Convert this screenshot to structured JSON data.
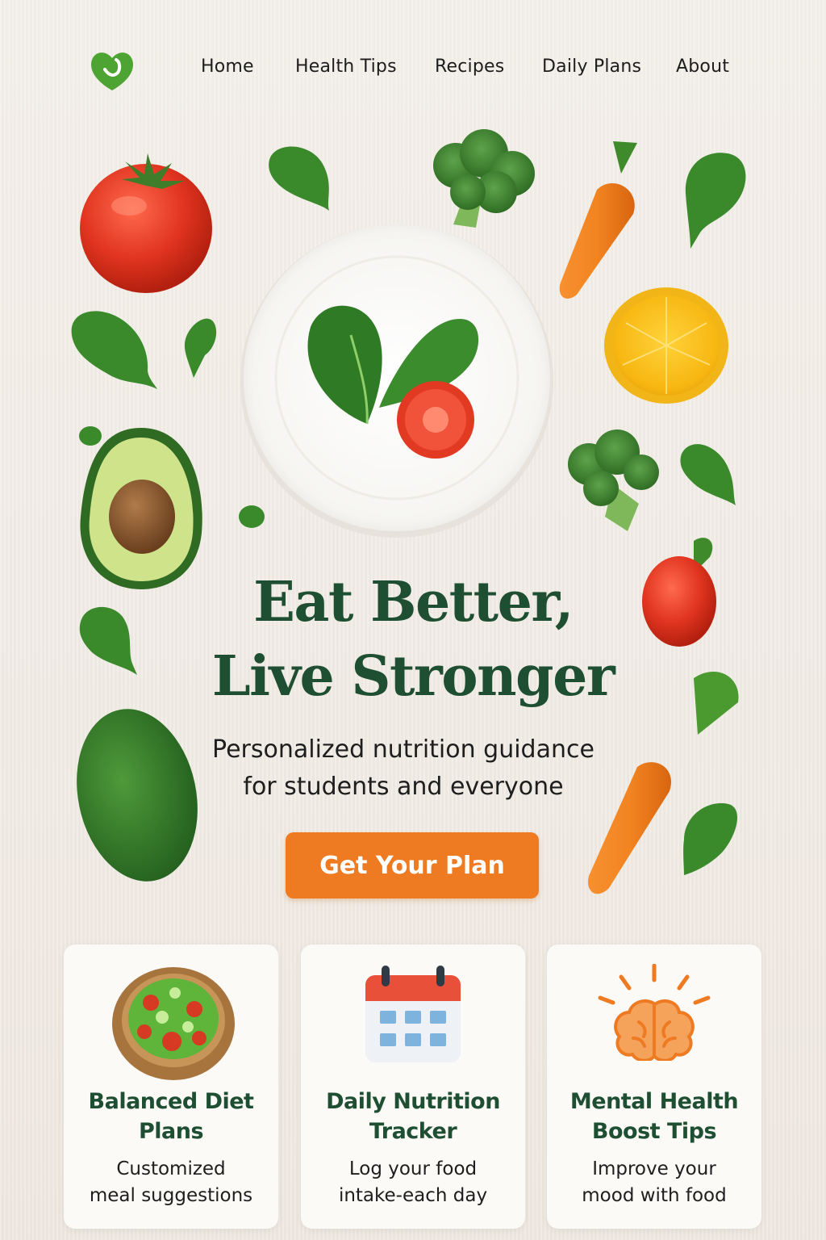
{
  "nav": {
    "logo": "leaf-heart-logo",
    "items": [
      "Home",
      "Health Tips",
      "Recipes",
      "Daily Plans",
      "About"
    ]
  },
  "hero": {
    "headline_line1": "Eat Better,",
    "headline_line2": "Live Stronger",
    "subhead_line1": "Personalized nutrition guidance",
    "subhead_line2": "for students and everyone",
    "cta_label": "Get Your Plan"
  },
  "cards": [
    {
      "icon": "salad-bowl-icon",
      "title_line1": "Balanced Diet",
      "title_line2": "Plans",
      "desc_line1": "Customized",
      "desc_line2": "meal suggestions"
    },
    {
      "icon": "calendar-icon",
      "title_line1": "Daily Nutrition",
      "title_line2": "Tracker",
      "desc_line1": "Log your food",
      "desc_line2": "intake-each day"
    },
    {
      "icon": "brain-icon",
      "title_line1": "Mental Health",
      "title_line2": "Boost Tips",
      "desc_line1": "Improve your",
      "desc_line2": "mood with food"
    }
  ],
  "colors": {
    "brand_green": "#1f4f33",
    "accent_orange": "#ee7a22",
    "background": "#f0ebe4"
  }
}
